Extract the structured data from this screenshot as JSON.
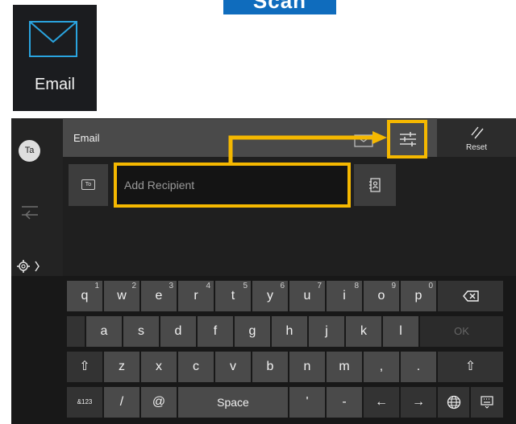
{
  "scan_button": {
    "label": "Scan"
  },
  "email_tile": {
    "label": "Email"
  },
  "screen": {
    "avatar_initials": "Ta",
    "title": "Email",
    "reset_label": "Reset",
    "to_label": "To",
    "recipient_placeholder": "Add Recipient",
    "icons": {
      "back": "back-arrow-icon",
      "mail": "envelope-icon",
      "settings": "sliders-icon",
      "reset": "reset-icon",
      "address_book": "address-book-icon",
      "keyboard_settings": "gear-icon"
    }
  },
  "highlight_color": "#f5b800",
  "keyboard": {
    "row1": [
      {
        "label": "q",
        "num": "1"
      },
      {
        "label": "w",
        "num": "2"
      },
      {
        "label": "e",
        "num": "3"
      },
      {
        "label": "r",
        "num": "4"
      },
      {
        "label": "t",
        "num": "5"
      },
      {
        "label": "y",
        "num": "6"
      },
      {
        "label": "u",
        "num": "7"
      },
      {
        "label": "i",
        "num": "8"
      },
      {
        "label": "o",
        "num": "9"
      },
      {
        "label": "p",
        "num": "0"
      }
    ],
    "row2": [
      "a",
      "s",
      "d",
      "f",
      "g",
      "h",
      "j",
      "k",
      "l"
    ],
    "ok_label": "OK",
    "row3": [
      "z",
      "x",
      "c",
      "v",
      "b",
      "n",
      "m",
      ",",
      "."
    ],
    "symbols_label": "&123",
    "slash": "/",
    "at": "@",
    "space_label": "Space",
    "apostrophe": "'",
    "dash": "-",
    "left_arrow": "←",
    "right_arrow": "→",
    "shift_glyph": "⇧"
  }
}
